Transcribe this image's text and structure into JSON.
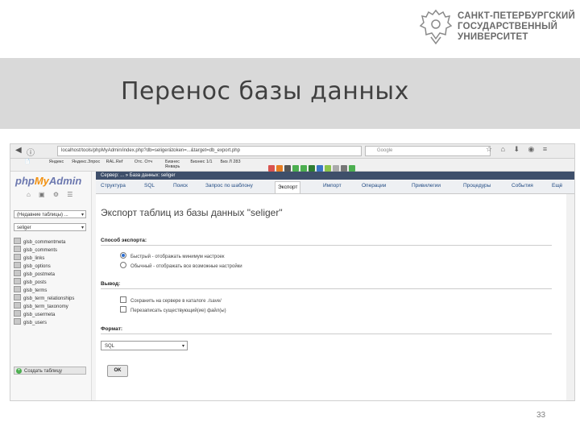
{
  "logo": {
    "lines": [
      "САНКТ-ПЕТЕРБУРГСКИЙ",
      "ГОСУДАРСТВЕННЫЙ",
      "УНИВЕРСИТЕТ"
    ],
    "accent": "#6b6b6b"
  },
  "slide": {
    "title": "Перенос базы данных",
    "page_number": "33",
    "band_color": "#d9d9d9"
  },
  "browser": {
    "url": "localhost/tools/phpMyAdmin/index.php?db=seliger&token=...&target=db_export.php",
    "search_placeholder": "Google",
    "bookmarks": [
      "Яндекс",
      "Яндекс.Зпрос",
      "RAL.Ref",
      "Отс. Отч",
      "Бизнес Январь",
      "Бизнес 1/1",
      "Биз Л 283"
    ]
  },
  "pma": {
    "logo": {
      "php": "php",
      "my": "My",
      "admin": "Admin"
    },
    "recent_select": "(Недавние таблицы) ...",
    "db_select": "seliger",
    "tables": [
      "glsb_commentmeta",
      "glsb_comments",
      "glsb_links",
      "glsb_options",
      "glsb_postmeta",
      "glsb_posts",
      "glsb_terms",
      "glsb_term_relationships",
      "glsb_term_taxonomy",
      "glsb_usermeta",
      "glsb_users"
    ],
    "create_table": "Создать таблицу",
    "breadcrumb": "Сервер: ... » База данных: seliger",
    "tabs": [
      "Структура",
      "SQL",
      "Поиск",
      "Запрос по шаблону",
      "Экспорт",
      "Импорт",
      "Операции",
      "Привилегии",
      "Процедуры",
      "События",
      "Ещё"
    ],
    "active_tab": "Экспорт",
    "heading": "Экспорт таблиц из базы данных \"seliger\"",
    "method_label": "Способ экспорта:",
    "method_options": [
      "Быстрый - отображать минимум настроек",
      "Обычный - отображать все возможные настройки"
    ],
    "output_label": "Вывод:",
    "output_options": [
      "Сохранить на сервере в каталоге ./save/",
      "Перезаписать существующий(ие) файл(ы)"
    ],
    "format_label": "Формат:",
    "format_value": "SQL",
    "ok_label": "OK"
  }
}
